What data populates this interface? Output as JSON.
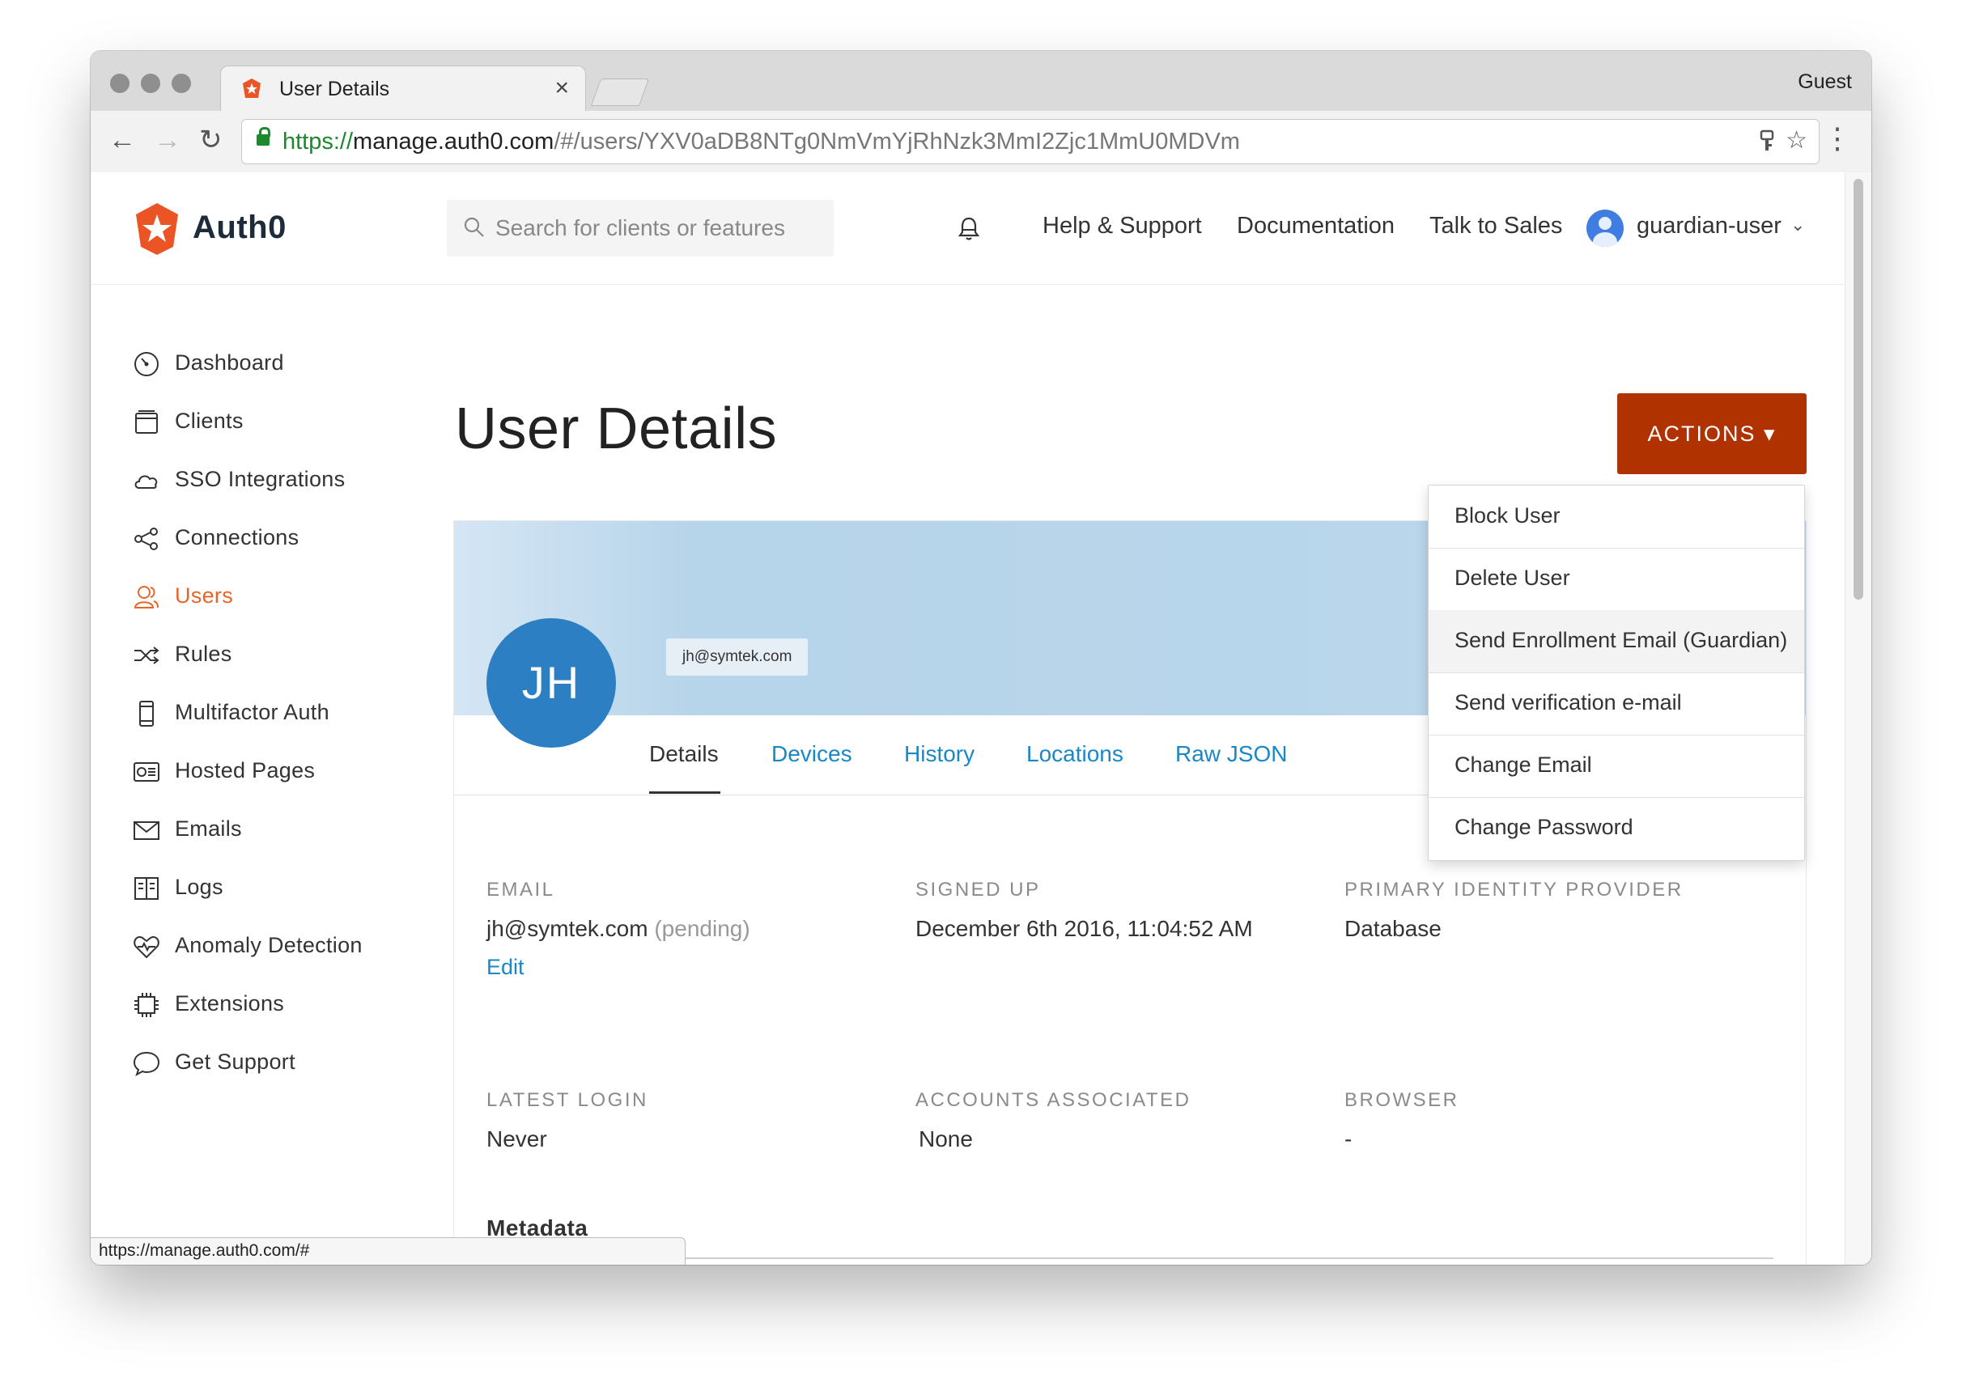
{
  "browser": {
    "tab_title": "User Details",
    "tab_close": "×",
    "profile": "Guest",
    "url_scheme": "https://",
    "url_host": "manage.auth0.com",
    "url_path": "/#/users/YXV0aDB8NTg0NmVmYjRhNzk3MmI2Zjc1MmU0MDVm",
    "status_url": "https://manage.auth0.com/#"
  },
  "header": {
    "brand": "Auth0",
    "search_placeholder": "Search for clients or features",
    "links": [
      "Help & Support",
      "Documentation",
      "Talk to Sales"
    ],
    "user": "guardian-user"
  },
  "sidebar": {
    "items": [
      {
        "label": "Dashboard",
        "icon": "dashboard-icon"
      },
      {
        "label": "Clients",
        "icon": "clients-icon"
      },
      {
        "label": "SSO Integrations",
        "icon": "cloud-icon"
      },
      {
        "label": "Connections",
        "icon": "connections-icon"
      },
      {
        "label": "Users",
        "icon": "users-icon",
        "active": true
      },
      {
        "label": "Rules",
        "icon": "shuffle-icon"
      },
      {
        "label": "Multifactor Auth",
        "icon": "phone-icon"
      },
      {
        "label": "Hosted Pages",
        "icon": "hosted-pages-icon"
      },
      {
        "label": "Emails",
        "icon": "envelope-icon"
      },
      {
        "label": "Logs",
        "icon": "book-icon"
      },
      {
        "label": "Anomaly Detection",
        "icon": "heart-pulse-icon"
      },
      {
        "label": "Extensions",
        "icon": "chip-icon"
      },
      {
        "label": "Get Support",
        "icon": "chat-bubble-icon"
      }
    ]
  },
  "main": {
    "title": "User Details",
    "actions_label": "ACTIONS ▾",
    "avatar_initials": "JH",
    "banner_email": "jh@symtek.com",
    "tabs": [
      "Details",
      "Devices",
      "History",
      "Locations",
      "Raw JSON"
    ],
    "fields": {
      "email_label": "EMAIL",
      "email_value": "jh@symtek.com",
      "email_status": "(pending)",
      "edit_label": "Edit",
      "signed_up_label": "SIGNED UP",
      "signed_up_value": "December 6th 2016, 11:04:52 AM",
      "provider_label": "PRIMARY IDENTITY PROVIDER",
      "provider_value": "Database",
      "latest_login_label": "LATEST LOGIN",
      "latest_login_value": "Never",
      "accounts_label": "ACCOUNTS ASSOCIATED",
      "accounts_value": "None",
      "browser_label": "BROWSER",
      "browser_value": "-"
    },
    "metadata_heading": "Metadata"
  },
  "actions_menu": [
    "Block User",
    "Delete User",
    "Send Enrollment Email (Guardian)",
    "Send verification e-mail",
    "Change Email",
    "Change Password"
  ],
  "colors": {
    "accent": "#e8652a",
    "actions_button": "#b03200",
    "link": "#1a87c6",
    "avatar": "#2d7fc3"
  }
}
